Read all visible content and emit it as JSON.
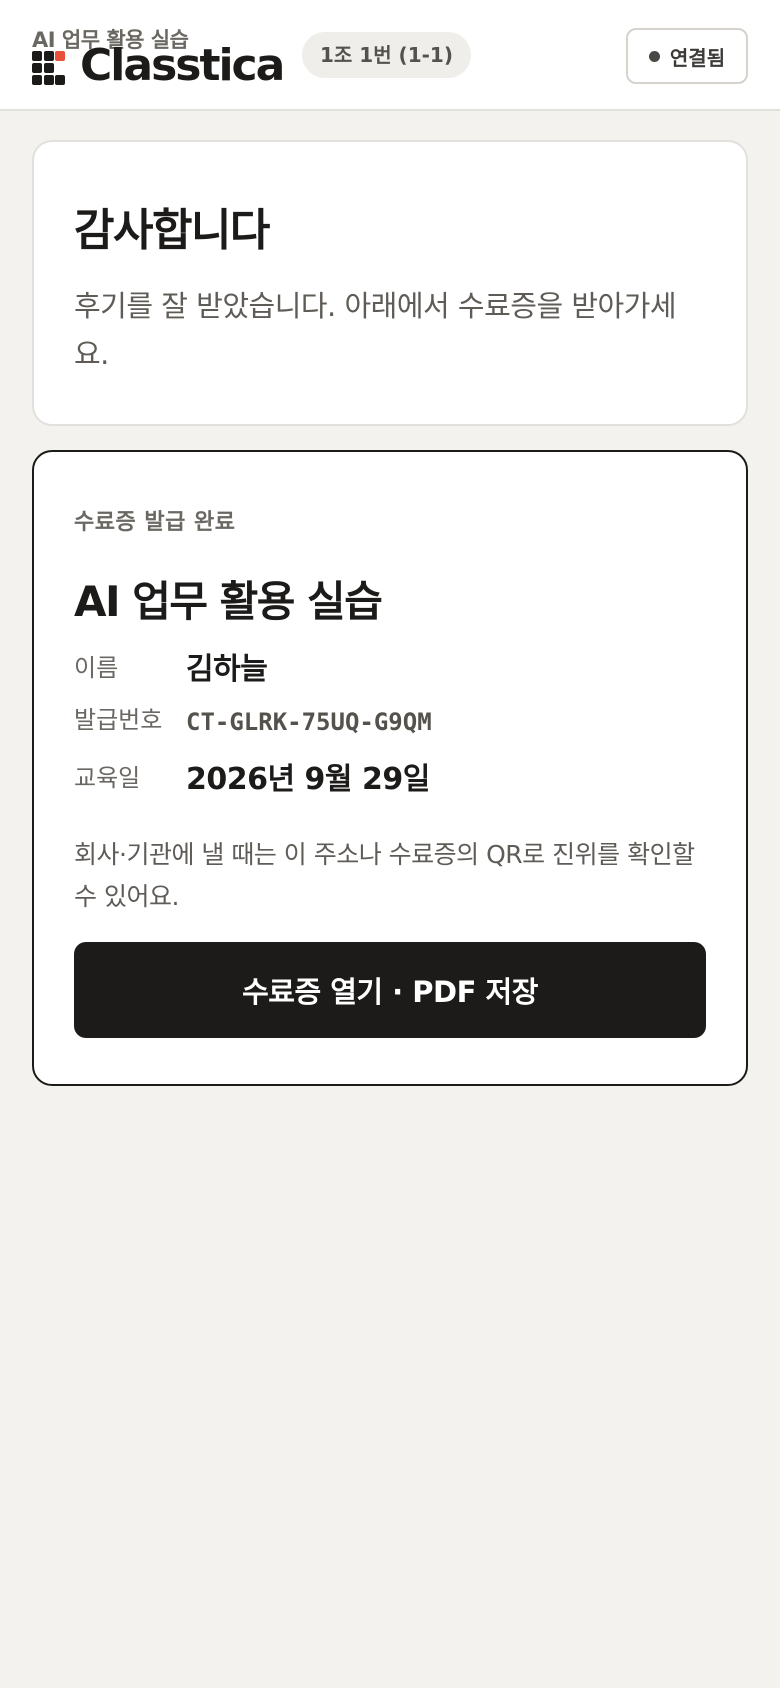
{
  "header": {
    "brand_sub": "AI 업무 활용 실습",
    "brand_name": "Classtica",
    "team_label": "1조 1번 (1-1)",
    "status_label": "연결됨",
    "logo_accent": "#e8523a"
  },
  "thanks": {
    "title": "감사합니다",
    "body": "후기를 잘 받았습니다. 아래에서 수료증을 받아가세요."
  },
  "certificate": {
    "kicker": "수료증 발급 완료",
    "course_title": "AI 업무 활용 실습",
    "fields": [
      {
        "label": "이름",
        "value": "김하늘"
      },
      {
        "label": "발급번호",
        "value": "CT-GLRK-75UQ-G9QM"
      },
      {
        "label": "교육일",
        "value": "2026년 9월 29일"
      }
    ],
    "note": "회사·기관에 낼 때는 이 주소나 수료증의 QR로 진위를 확인할 수 있어요.",
    "button_label": "수료증 열기 · PDF 저장"
  }
}
